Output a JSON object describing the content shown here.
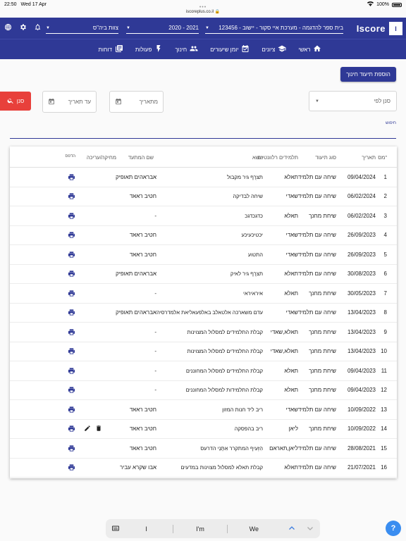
{
  "status": {
    "time": "22:50",
    "date": "Wed 17 Apr",
    "battery": "100%"
  },
  "url": "iscoreplus.co.il",
  "topbar": {
    "brand": "Iscore",
    "brand_box": "I",
    "school": "123456 - בית ספר להדגמה - מערכת איי סקור - יישוב",
    "year": "2020 - 2021",
    "team": "צוות ביה\"ס"
  },
  "nav": [
    {
      "label": "ראשי",
      "icon": "home-icon"
    },
    {
      "label": "ציונים",
      "icon": "school-icon"
    },
    {
      "label": "יומן שיעורים",
      "icon": "calendar-icon"
    },
    {
      "label": "חינוך",
      "icon": "people-icon"
    },
    {
      "label": "פעולות",
      "icon": "bolt-icon"
    },
    {
      "label": "דוחות",
      "icon": "reports-icon"
    }
  ],
  "actions": {
    "add_label": "הוספת תיעוד חינוך"
  },
  "filters": {
    "sort_label": "סנן לפי",
    "from_label": "מתאריך",
    "to_label": "עד תאריך",
    "filter_button": "סנן"
  },
  "search": {
    "label": "חיפוש"
  },
  "table": {
    "headers": {
      "num": "מס\"",
      "date": "תאריך",
      "type": "סוג תיעוד",
      "students": "תלמידים רלוונטיים",
      "subject": "נושא",
      "teacher": "שם המתעד",
      "editor": "מחיקה/עריכה",
      "print": "הדפס"
    },
    "rows": [
      {
        "num": "1",
        "date": "09/04/2024",
        "type": "שיחה עם תלמיד",
        "students": "תאלא",
        "subject": "תצרֻף גיר מקבול",
        "teacher": "אבראהים תאופיק",
        "editable": false
      },
      {
        "num": "2",
        "date": "06/02/2024",
        "type": "שיחה עם תלמיד",
        "students": "שאדי",
        "subject": "שיחה לבדיקה",
        "teacher": "חטיב ראאד",
        "editable": false
      },
      {
        "num": "3",
        "date": "06/02/2024",
        "type": "שיחת מחנך",
        "students": "תאלא",
        "subject": "כדגכדגכ",
        "teacher": "-",
        "editable": false
      },
      {
        "num": "4",
        "date": "26/09/2023",
        "type": "שיחה עם תלמיד",
        "students": "שאדי",
        "subject": "יכטיכעיכע",
        "teacher": "חטיב ראאד",
        "editable": false
      },
      {
        "num": "5",
        "date": "26/09/2023",
        "type": "שיחה עם תלמיד",
        "students": "שאדי",
        "subject": "התטוע",
        "teacher": "חטיב ראאד",
        "editable": false
      },
      {
        "num": "6",
        "date": "30/08/2023",
        "type": "שיחה עם תלמיד",
        "students": "תאלא",
        "subject": "תצרֻף גיר לאיק",
        "teacher": "אבראהים תאופיק",
        "editable": false
      },
      {
        "num": "7",
        "date": "30/05/2023",
        "type": "שיחת מחנך",
        "students": "תאלא",
        "subject": "איראיראי",
        "teacher": "-",
        "editable": false
      },
      {
        "num": "8",
        "date": "13/04/2023",
        "type": "שיחה עם תלמיד",
        "students": "שאדי",
        "subject": "עדם משארכה אלטאלב באלפעאליאת אלמדרסיה",
        "teacher": "אבראהים תאופיק",
        "editable": false
      },
      {
        "num": "9",
        "date": "13/04/2023",
        "type": "שיחת מחנך",
        "students": "תאלא,שאדי",
        "subject": "קבלת התלמידים למסלול המצוינות",
        "teacher": "-",
        "editable": false
      },
      {
        "num": "10",
        "date": "13/04/2023",
        "type": "שיחת מחנך",
        "students": "תאלא,שאדי",
        "subject": "קבלת התלמידים למסלול המצוינות",
        "teacher": "-",
        "editable": false
      },
      {
        "num": "11",
        "date": "09/04/2023",
        "type": "שיחת מחנך",
        "students": "תאלא",
        "subject": "קבלת התלמידים למסלול המחוננים",
        "teacher": "-",
        "editable": false
      },
      {
        "num": "12",
        "date": "09/04/2023",
        "type": "שיחת מחנך",
        "students": "תאלא",
        "subject": "קבלת התלמידות למסלול המחוננים",
        "teacher": "-",
        "editable": false
      },
      {
        "num": "13",
        "date": "10/09/2022",
        "type": "שיחה עם תלמיד",
        "students": "שאדי",
        "subject": "ריב ליד חנות המזון",
        "teacher": "חטיב ראאד",
        "editable": false
      },
      {
        "num": "14",
        "date": "10/09/2022",
        "type": "שיחת מחנך",
        "students": "ליאן",
        "subject": "ריב בהפסקה",
        "teacher": "חטיב ראאד",
        "editable": true
      },
      {
        "num": "15",
        "date": "28/08/2021",
        "type": "שיחה עם תלמיד",
        "students": "ליאן,תאראם",
        "subject": "הִזְעִיף המתקרר אִתָּנֵי הדרעס",
        "teacher": "חטיב ראאד",
        "editable": false
      },
      {
        "num": "16",
        "date": "21/07/2021",
        "type": "שיחה עם תלמיד",
        "students": "תאלא",
        "subject": "קבלת תאלא למסלול מצוינות במדעים",
        "teacher": "אבו שקרא עביר",
        "editable": false
      }
    ]
  },
  "keyboard": {
    "suggestions": [
      "I",
      "I'm",
      "We"
    ]
  },
  "help": {
    "label": "?"
  }
}
